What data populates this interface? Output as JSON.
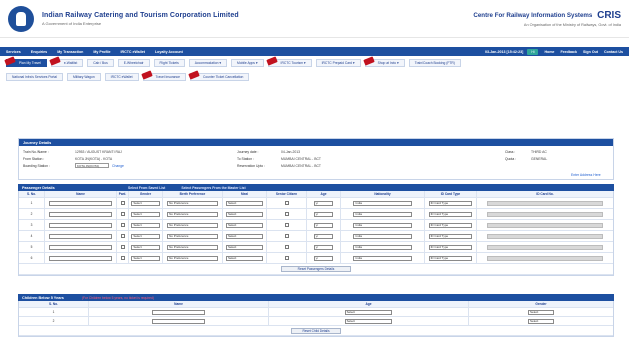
{
  "header": {
    "org_title": "Indian Railway Catering and Tourism Corporation Limited",
    "org_subtitle": "A Government of India Enterprise",
    "right_title": "Centre For Railway Information Systems",
    "right_subtitle": "An Organisation of the Ministry of Railways, Govt. of India",
    "right_logo_text": "CRIS"
  },
  "nav": {
    "left_items": [
      "Services",
      "Enquiries",
      "My Transaction",
      "My Profile",
      "IRCTC eWallet",
      "Loyalty Account"
    ],
    "right_items": [
      "Home",
      "Feedback",
      "Sign Out",
      "Contact Us"
    ],
    "timestamp": "03-Jan-2013 [15:42:23]",
    "badge": "Hi"
  },
  "tabs_primary": [
    {
      "label": "Plan My Travel",
      "hot": true,
      "active": true
    },
    {
      "label": "e-Waitlist",
      "hot": true,
      "active": false
    },
    {
      "label": "Cab / Bus",
      "hot": false,
      "active": false
    },
    {
      "label": "E-Wheelchair",
      "hot": false,
      "active": false
    },
    {
      "label": "Flight Tickets",
      "hot": false,
      "active": false
    },
    {
      "label": "Accommodation ▾",
      "hot": false,
      "active": false
    },
    {
      "label": "Mobile Apps ▾",
      "hot": false,
      "active": false
    },
    {
      "label": "IRCTC Tourism ▾",
      "hot": true,
      "active": false
    },
    {
      "label": "IRCTC Prepaid Card ▾",
      "hot": false,
      "active": false
    },
    {
      "label": "Shop at Irctc ▾",
      "hot": true,
      "active": false
    },
    {
      "label": "Train/Coach Booking (FTR)",
      "hot": false,
      "active": false
    }
  ],
  "tabs_secondary": [
    {
      "label": "National Infra's Services Portal",
      "hot": false
    },
    {
      "label": "Military Wagon",
      "hot": false
    },
    {
      "label": "IRCTC eWallet",
      "hot": false
    },
    {
      "label": "Travel Insurance",
      "hot": true
    },
    {
      "label": "Counter Ticket Cancellation",
      "hot": true
    }
  ],
  "journey": {
    "title": "Journey Details",
    "labels": {
      "train_no": "Train No./Name :",
      "from_station": "From Station :",
      "boarding_station": "Boarding Station :",
      "journey_date": "Journey date :",
      "to_station": "To Station :",
      "reservation_upto": "Reservation Upto :",
      "class": "Class :",
      "quota": "Quota :"
    },
    "values": {
      "train_no": "12953 / AUGUST KRANTI RAJ",
      "from_station": "KOTA JN(KOTA) - KOTA",
      "boarding_station": "KOTA JN(KOTA)",
      "journey_date": "04-Jan-2013",
      "to_station": "MUMBAI CENTRAL - BCT",
      "reservation_upto": "MUMBAI CENTRAL - BCT",
      "class": "THIRD AC",
      "quota": "GENERAL"
    },
    "boarding_link": "Change",
    "enter_address_link": "Enter Address Here"
  },
  "passenger": {
    "title": "Passenger Details",
    "select_list": "Select From Saved List",
    "select_prev": "Select Passengers From the Master List",
    "columns": [
      "S. No.",
      "Name",
      "Pwd.",
      "Gender",
      "Berth Preference",
      "Meal",
      "Senior Citizen",
      "Age",
      "Nationality",
      "ID Card Type",
      "ID Card No."
    ],
    "rows": [
      {
        "sno": "1",
        "gender": "Select",
        "berth": "No Preference",
        "meal": "Select",
        "age": "yr",
        "nationality": "India",
        "idtype": "ID Card Type"
      },
      {
        "sno": "2",
        "gender": "Select",
        "berth": "No Preference",
        "meal": "Select",
        "age": "yr",
        "nationality": "India",
        "idtype": "ID Card Type"
      },
      {
        "sno": "3",
        "gender": "Select",
        "berth": "No Preference",
        "meal": "Select",
        "age": "yr",
        "nationality": "India",
        "idtype": "ID Card Type"
      },
      {
        "sno": "4",
        "gender": "Select",
        "berth": "No Preference",
        "meal": "Select",
        "age": "yr",
        "nationality": "India",
        "idtype": "ID Card Type"
      },
      {
        "sno": "5",
        "gender": "Select",
        "berth": "No Preference",
        "meal": "Select",
        "age": "yr",
        "nationality": "India",
        "idtype": "ID Card Type"
      },
      {
        "sno": "6",
        "gender": "Select",
        "berth": "No Preference",
        "meal": "Select",
        "age": "yr",
        "nationality": "India",
        "idtype": "ID Card Type"
      }
    ],
    "reset_button": "Reset Passengers Details"
  },
  "children": {
    "title": "Children Below 5 Years",
    "note": "(For Children below 5 years, no ticket is required)",
    "columns": [
      "S. No.",
      "Name",
      "Age",
      "Gender"
    ],
    "rows": [
      {
        "sno": "1",
        "age": "Select",
        "gender": "Select"
      },
      {
        "sno": "2",
        "age": "Select",
        "gender": "Select"
      }
    ],
    "reset_button": "Reset Child Details"
  },
  "colors": {
    "primary": "#1d4fa0",
    "hot_flag": "#c1121f",
    "badge": "#2fa69a",
    "note": "#ff5a7a"
  }
}
